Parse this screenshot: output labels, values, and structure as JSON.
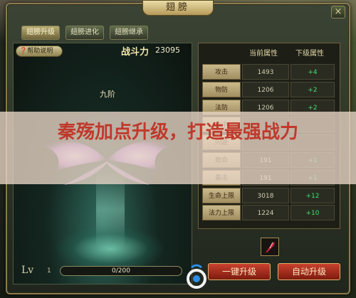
{
  "window": {
    "title": "翅膀",
    "close_label": "×"
  },
  "tabs": [
    {
      "label": "翅膀升级",
      "active": true
    },
    {
      "label": "翅膀进化",
      "active": false
    },
    {
      "label": "翅膀继承",
      "active": false
    }
  ],
  "left": {
    "help_label": "帮助说明",
    "power_label": "战斗力",
    "power_value": "23095",
    "stage_label": "九阶",
    "lv_label": "Lv",
    "lv_value": "1",
    "exp_text": "0/200",
    "exp_fraction": 0.0
  },
  "stats": {
    "header_current": "当前属性",
    "header_upgrade": "下级属性",
    "rows": [
      {
        "name": "攻击",
        "current": "1493",
        "upgrade": "+4"
      },
      {
        "name": "物防",
        "current": "1206",
        "upgrade": "+2"
      },
      {
        "name": "法防",
        "current": "1206",
        "upgrade": "+2"
      },
      {
        "name": "命中",
        "current": "",
        "upgrade": ""
      },
      {
        "name": "闪避",
        "current": "",
        "upgrade": ""
      },
      {
        "name": "致命",
        "current": "191",
        "upgrade": "+1"
      },
      {
        "name": "暴击",
        "current": "191",
        "upgrade": "+1"
      },
      {
        "name": "生命上限",
        "current": "3018",
        "upgrade": "+12"
      },
      {
        "name": "法力上限",
        "current": "1224",
        "upgrade": "+10"
      }
    ]
  },
  "buttons": {
    "upgrade_label": "一键升级",
    "auto_label": "自动升级"
  },
  "overlay": {
    "headline": "秦殇加点升级，打造最强战力"
  },
  "colors": {
    "accent_red": "#c0392b",
    "upgrade_green": "#3fe06d",
    "gold_border": "#8a7a4c"
  }
}
